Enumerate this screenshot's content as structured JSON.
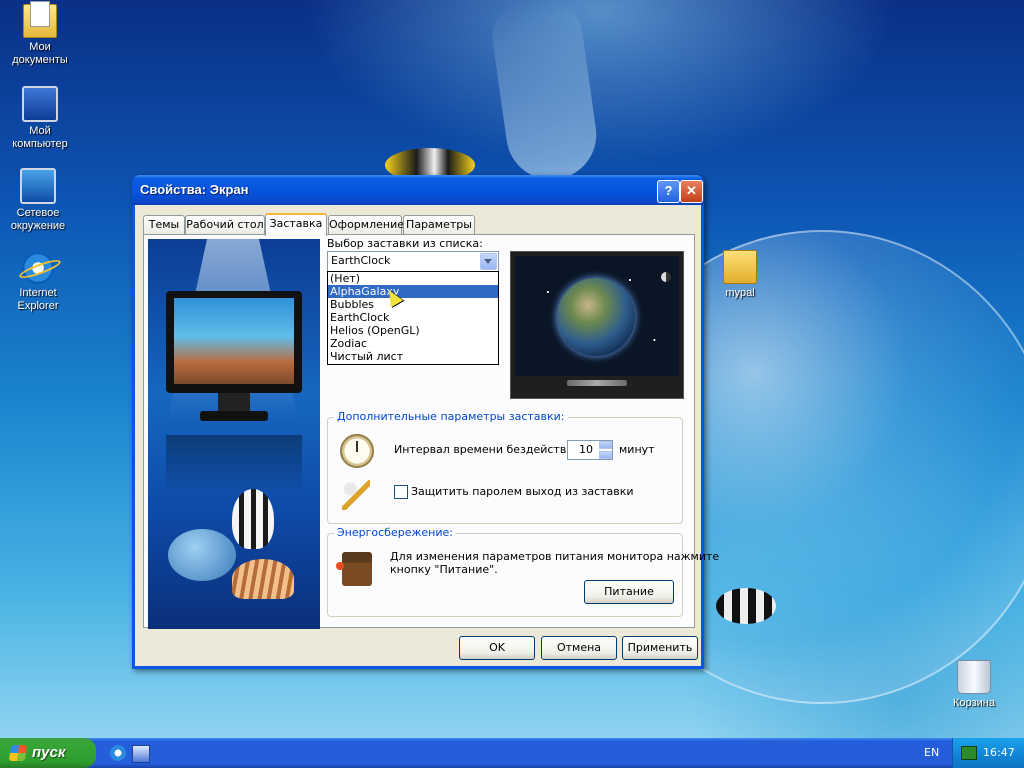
{
  "desktop": {
    "icons": [
      {
        "label": "Мои документы",
        "icon": "my-documents-icon"
      },
      {
        "label": "Мой компьютер",
        "icon": "my-computer-icon"
      },
      {
        "label": "Сетевое окружение",
        "icon": "network-places-icon"
      },
      {
        "label": "Internet Explorer",
        "icon": "internet-explorer-icon"
      },
      {
        "label": "mypal",
        "icon": "folder-icon"
      },
      {
        "label": "Корзина",
        "icon": "recycle-bin-icon"
      }
    ]
  },
  "dialog": {
    "title": "Свойства: Экран",
    "help_glyph": "?",
    "close_glyph": "✕",
    "tabs": [
      "Темы",
      "Рабочий стол",
      "Заставка",
      "Оформление",
      "Параметры"
    ],
    "active_tab": "Заставка",
    "screensaver": {
      "select_label": "Выбор заставки из списка:",
      "selected": "EarthClock",
      "options": [
        "(Нет)",
        "AlphaGalaxy",
        "Bubbles",
        "EarthClock",
        "Helios (OpenGL)",
        "Zodiac",
        "Чистый лист"
      ],
      "highlighted": "AlphaGalaxy"
    },
    "extra_group": {
      "legend": "Дополнительные параметры заставки:",
      "interval_label": "Интервал времени бездействия:",
      "interval_value": "10",
      "interval_unit": "минут",
      "password_label": "Защитить паролем выход из заставки",
      "password_checked": false
    },
    "power_group": {
      "legend": "Энергосбережение:",
      "text_line1": "Для изменения параметров питания монитора нажмите",
      "text_line2": "кнопку \"Питание\".",
      "button": "Питание"
    },
    "buttons": {
      "ok": "OK",
      "cancel": "Отмена",
      "apply": "Применить"
    }
  },
  "taskbar": {
    "start_label": "пуск",
    "language": "EN",
    "time": "16:47",
    "colors": {
      "start": "#37a737",
      "bar": "#245edb"
    }
  }
}
